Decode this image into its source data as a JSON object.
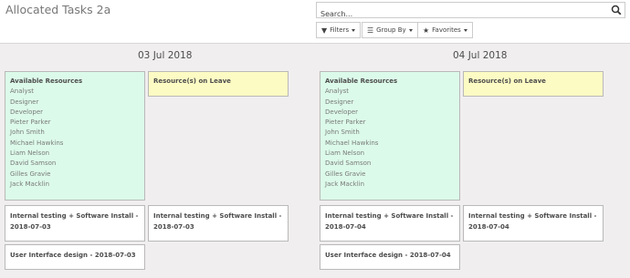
{
  "header": {
    "title": "Allocated Tasks 2a"
  },
  "search": {
    "placeholder": "Search..."
  },
  "filters": {
    "filters_label": "Filters",
    "groupby_label": "Group By",
    "favorites_label": "Favorites"
  },
  "days": [
    {
      "date": "03 Jul 2018",
      "available_title": "Available Resources",
      "resources": [
        "Analyst",
        "Designer",
        "Developer",
        "Pieter Parker",
        "John Smith",
        "Michael Hawkins",
        "Liam Nelson",
        "David Samson",
        "Gilles Gravie",
        "Jack Macklin"
      ],
      "leave_title": "Resource(s) on Leave",
      "tasks": [
        "Internal testing + Software Install - 2018-07-03",
        "Internal testing + Software Install - 2018-07-03",
        "User Interface design - 2018-07-03"
      ]
    },
    {
      "date": "04 Jul 2018",
      "available_title": "Available Resources",
      "resources": [
        "Analyst",
        "Designer",
        "Developer",
        "Pieter Parker",
        "John Smith",
        "Michael Hawkins",
        "Liam Nelson",
        "David Samson",
        "Gilles Gravie",
        "Jack Macklin"
      ],
      "leave_title": "Resource(s) on Leave",
      "tasks": [
        "Internal testing + Software Install - 2018-07-04",
        "Internal testing + Software Install - 2018-07-04",
        "User Interface design - 2018-07-04"
      ]
    }
  ]
}
